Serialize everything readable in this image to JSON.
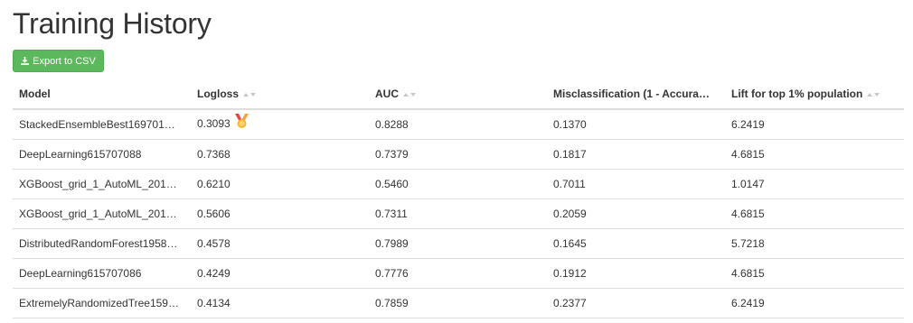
{
  "page": {
    "title": "Training History"
  },
  "toolbar": {
    "export_label": "Export to CSV",
    "export_icon": "download-icon"
  },
  "colors": {
    "export_bg": "#5cb85c",
    "border": "#dddddd",
    "text": "#333333"
  },
  "table": {
    "columns": [
      {
        "label": "Model"
      },
      {
        "label": "Logloss"
      },
      {
        "label": "AUC"
      },
      {
        "label": "Misclassification (1 - Accura…"
      },
      {
        "label": "Lift for top 1% population"
      }
    ],
    "rows": [
      {
        "cells": [
          "StackedEnsembleBest169701…",
          "0.3093",
          "0.8288",
          "0.1370",
          "6.2419"
        ],
        "badge": "medal-icon"
      },
      {
        "cells": [
          "DeepLearning615707088",
          "0.7368",
          "0.7379",
          "0.1817",
          "4.6815"
        ]
      },
      {
        "cells": [
          "XGBoost_grid_1_AutoML_201…",
          "0.6210",
          "0.5460",
          "0.7011",
          "1.0147"
        ]
      },
      {
        "cells": [
          "XGBoost_grid_1_AutoML_201…",
          "0.5606",
          "0.7311",
          "0.2059",
          "4.6815"
        ]
      },
      {
        "cells": [
          "DistributedRandomForest1958…",
          "0.4578",
          "0.7989",
          "0.1645",
          "5.7218"
        ]
      },
      {
        "cells": [
          "DeepLearning615707086",
          "0.4249",
          "0.7776",
          "0.1912",
          "4.6815"
        ]
      },
      {
        "cells": [
          "ExtremelyRandomizedTree159…",
          "0.4134",
          "0.7859",
          "0.2377",
          "6.2419"
        ]
      }
    ]
  }
}
